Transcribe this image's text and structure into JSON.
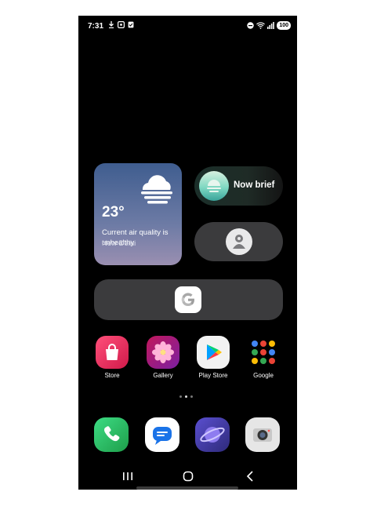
{
  "status_bar": {
    "time": "7:31",
    "battery": "100",
    "left_icons": [
      "download-icon",
      "screenshot-icon",
      "clipboard-icon"
    ],
    "right_icons": [
      "do-not-disturb-icon",
      "wifi-icon",
      "signal-icon",
      "battery-icon"
    ]
  },
  "weather": {
    "temperature": "23°",
    "description": "Current air quality is unhealthy",
    "location": "New Delhi",
    "icon": "fog-icon"
  },
  "now_brief": {
    "label": "Now brief"
  },
  "apps": [
    {
      "label": "Store",
      "icon": "galaxy-store-icon"
    },
    {
      "label": "Gallery",
      "icon": "gallery-icon"
    },
    {
      "label": "Play Store",
      "icon": "play-store-icon"
    },
    {
      "label": "Google",
      "icon": "google-folder-icon"
    }
  ],
  "dock": [
    {
      "name": "phone",
      "icon": "phone-icon"
    },
    {
      "name": "messages",
      "icon": "messages-icon"
    },
    {
      "name": "internet",
      "icon": "internet-icon"
    },
    {
      "name": "camera",
      "icon": "camera-icon"
    }
  ],
  "page_indicator": {
    "pages": 3,
    "current": 2
  },
  "colors": {
    "background": "#000000",
    "widget_gray": "#3b3b3d",
    "weather_top": "#3f5d8f",
    "weather_bottom": "#9a8fb1"
  }
}
